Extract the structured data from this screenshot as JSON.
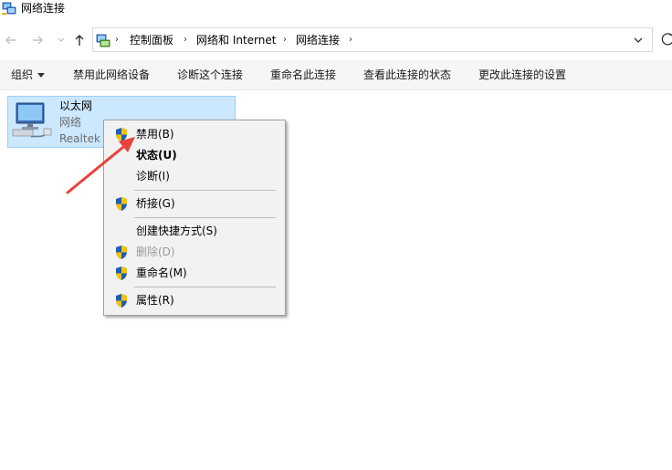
{
  "window": {
    "title": "网络连接",
    "title_icon": "network-connections-icon"
  },
  "nav": {
    "back_icon": "arrow-left-icon",
    "forward_icon": "arrow-right-icon",
    "recent_icon": "chevron-down-icon",
    "up_icon": "arrow-up-icon",
    "refresh_icon": "refresh-icon"
  },
  "address": {
    "breadcrumbs": [
      "控制面板",
      "网络和 Internet",
      "网络连接"
    ],
    "separator": "›"
  },
  "commandbar": {
    "organize": "组织",
    "disable_device": "禁用此网络设备",
    "diagnose": "诊断这个连接",
    "rename": "重命名此连接",
    "view_status": "查看此连接的状态",
    "change_settings": "更改此连接的设置"
  },
  "connection": {
    "name": "以太网",
    "status": "网络",
    "adapter": "Realtek",
    "icon": "ethernet-adapter-icon"
  },
  "context_menu": {
    "items": [
      {
        "label": "禁用(B)",
        "icon": "uac-shield-icon",
        "bold": false,
        "disabled": false
      },
      {
        "label": "状态(U)",
        "icon": "",
        "bold": true,
        "disabled": false
      },
      {
        "label": "诊断(I)",
        "icon": "",
        "bold": false,
        "disabled": false
      },
      {
        "label": "桥接(G)",
        "icon": "uac-shield-icon",
        "bold": false,
        "disabled": false
      },
      {
        "label": "创建快捷方式(S)",
        "icon": "",
        "bold": false,
        "disabled": false
      },
      {
        "label": "删除(D)",
        "icon": "uac-shield-icon",
        "bold": false,
        "disabled": true
      },
      {
        "label": "重命名(M)",
        "icon": "uac-shield-icon",
        "bold": false,
        "disabled": false
      },
      {
        "label": "属性(R)",
        "icon": "uac-shield-icon",
        "bold": false,
        "disabled": false
      }
    ]
  },
  "annotation": {
    "arrow_color": "#e8423b",
    "selection_color": "#cce8ff"
  }
}
